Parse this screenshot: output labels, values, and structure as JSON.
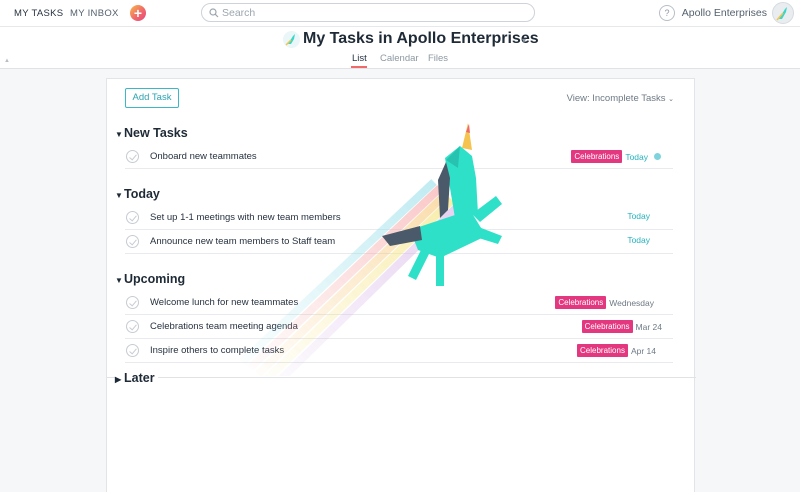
{
  "topbar": {
    "my_tasks": "MY TASKS",
    "my_inbox": "MY INBOX",
    "quick_add": "+",
    "search_placeholder": "Search",
    "help": "?",
    "org_name": "Apollo Enterprises"
  },
  "header": {
    "title": "My Tasks in Apollo Enterprises",
    "tabs": [
      {
        "label": "List",
        "active": true
      },
      {
        "label": "Calendar",
        "active": false
      },
      {
        "label": "Files",
        "active": false
      }
    ]
  },
  "toolbar": {
    "add_task": "Add Task",
    "view_filter": "View: Incomplete Tasks"
  },
  "sections": [
    {
      "title": "New Tasks",
      "expanded": true,
      "tasks": [
        {
          "name": "Onboard new teammates",
          "tag": "Celebrations",
          "due": "Today",
          "due_today": true,
          "recurring": true
        }
      ]
    },
    {
      "title": "Today",
      "expanded": true,
      "tasks": [
        {
          "name": "Set up 1-1 meetings with new team members",
          "tag": "",
          "due": "Today",
          "due_today": true
        },
        {
          "name": "Announce new team members to Staff team",
          "tag": "",
          "due": "Today",
          "due_today": true
        }
      ]
    },
    {
      "title": "Upcoming",
      "expanded": true,
      "tasks": [
        {
          "name": "Welcome lunch for new teammates",
          "tag": "Celebrations",
          "due": "Wednesday",
          "due_today": false
        },
        {
          "name": "Celebrations team meeting agenda",
          "tag": "Celebrations",
          "due": "Mar 24",
          "due_today": false
        },
        {
          "name": "Inspire others to complete tasks",
          "tag": "Celebrations",
          "due": "Apr 14",
          "due_today": false
        }
      ]
    },
    {
      "title": "Later",
      "expanded": false,
      "tasks": []
    }
  ],
  "colors": {
    "accent": "#25b3bf",
    "tag": "#e3387f",
    "tab_underline": "#f06a6a"
  }
}
